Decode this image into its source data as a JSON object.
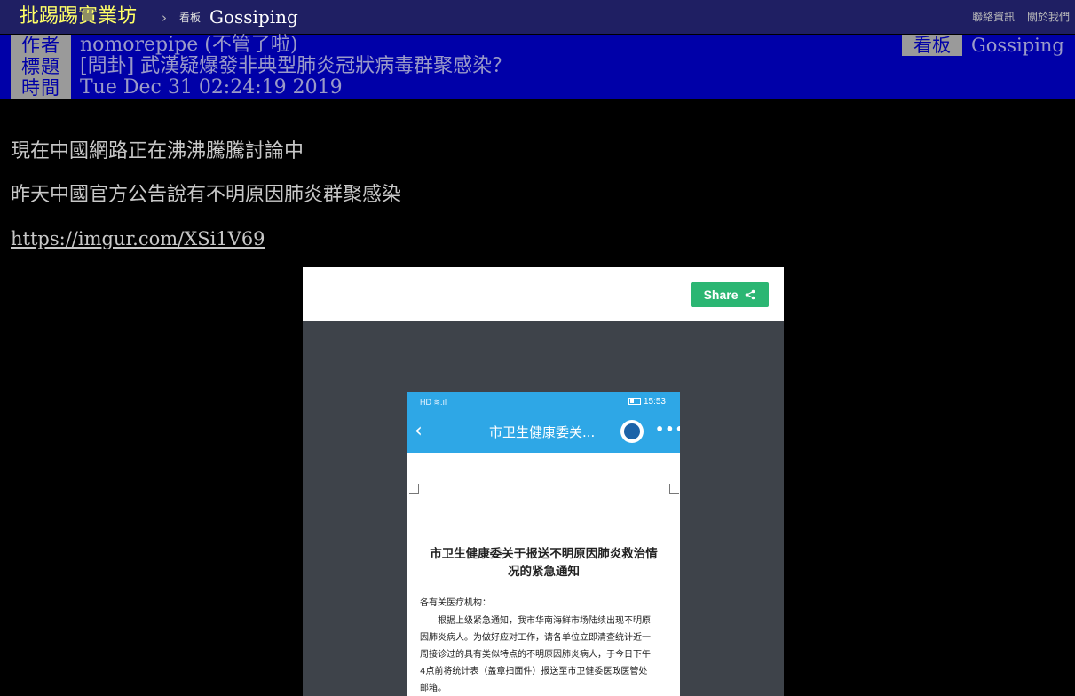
{
  "topbar": {
    "site_title": "批踢踢實業坊",
    "separator": "›",
    "board_label": "看板",
    "board_name": "Gossiping",
    "links": [
      "聯絡資訊",
      "關於我們"
    ]
  },
  "header": {
    "author_tag": "作者",
    "author": "nomorepipe (不管了啦)",
    "title_tag": "標題",
    "title": "[問卦] 武漢疑爆發非典型肺炎冠狀病毒群聚感染？",
    "time_tag": "時間",
    "time": "Tue Dec 31 02:24:19 2019",
    "board_tag": "看板",
    "board": "Gossiping"
  },
  "content": {
    "lines": [
      "現在中國網路正在沸沸騰騰討論中",
      "昨天中國官方公告說有不明原因肺炎群聚感染"
    ],
    "link": "https://imgur.com/XSi1V69"
  },
  "embed": {
    "share_label": "Share",
    "share_icon": "share-icon",
    "accent": "#2bb673",
    "phone": {
      "status_left": "HD ≋.ıl",
      "status_time": "15:53",
      "nav_back": "‹",
      "nav_title": "市卫生健康委关...",
      "nav_more": "•••",
      "doc_title_line1": "市卫生健康委关于报送不明原因肺炎救治情",
      "doc_title_line2": "况的紧急通知",
      "salutation": "各有关医疗机构：",
      "body_lines": [
        "　　根据上级紧急通知，我市华南海鲜市场陆续出现不明原",
        "因肺炎病人。为做好应对工作，请各单位立即清查统计近一",
        "周接诊过的具有类似特点的不明原因肺炎病人，于今日下午",
        "4点前将统计表（盖章扫面件）报送至市卫健委医政医管处",
        "邮箱。"
      ]
    }
  },
  "colors": {
    "topbar_bg": "#1f1f63",
    "site_title": "#ffff66",
    "meta_bg": "#0000a8",
    "meta_tag_bg": "#9a9a9a",
    "page_bg": "#000000",
    "phone_blue": "#2ea7e6"
  }
}
